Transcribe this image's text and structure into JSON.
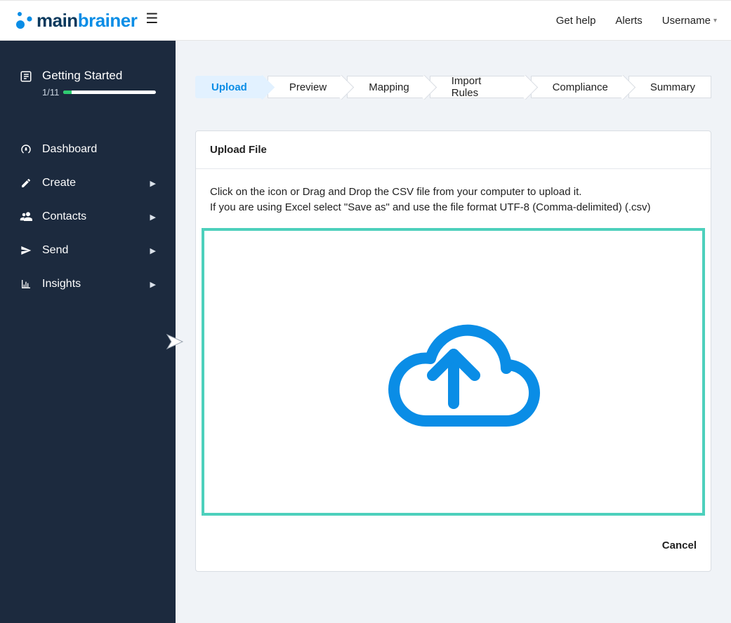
{
  "topbar": {
    "logo_part1": "main",
    "logo_part2": "brainer",
    "get_help": "Get help",
    "alerts": "Alerts",
    "username": "Username"
  },
  "sidebar": {
    "getting_started": {
      "label": "Getting Started",
      "progress_text": "1/11",
      "progress_percent": 9
    },
    "items": [
      {
        "label": "Dashboard",
        "has_children": false
      },
      {
        "label": "Create",
        "has_children": true
      },
      {
        "label": "Contacts",
        "has_children": true
      },
      {
        "label": "Send",
        "has_children": true
      },
      {
        "label": "Insights",
        "has_children": true
      }
    ]
  },
  "stepper": [
    {
      "label": "Upload",
      "active": true
    },
    {
      "label": "Preview",
      "active": false
    },
    {
      "label": "Mapping",
      "active": false
    },
    {
      "label": "Import Rules",
      "active": false
    },
    {
      "label": "Compliance",
      "active": false
    },
    {
      "label": "Summary",
      "active": false
    }
  ],
  "card": {
    "title": "Upload File",
    "instruction_line1": "Click on the icon or Drag and Drop the CSV file from your computer to upload it.",
    "instruction_line2": "If you are using Excel select \"Save as\" and use the file format UTF-8 (Comma-delimited) (.csv)",
    "cancel": "Cancel"
  }
}
